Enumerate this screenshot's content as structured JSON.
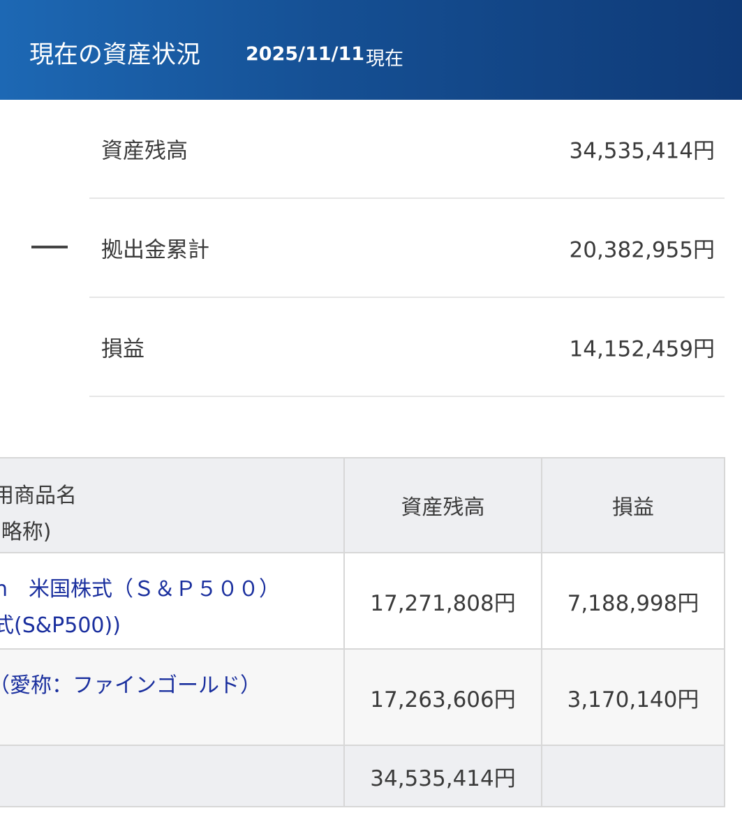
{
  "header": {
    "title": "現在の資産状況",
    "date": "2025/11/11",
    "as_of": "現在"
  },
  "summary": {
    "balance": {
      "label": "資産残高",
      "value": "34,535,414円"
    },
    "contribution": {
      "label": "拠出金累計",
      "value": "20,382,955円"
    },
    "profit": {
      "label": "損益",
      "value": "14,152,459円"
    }
  },
  "table": {
    "headers": {
      "name_line1": "用商品名",
      "name_line2": "(略称)",
      "balance": "資産残高",
      "profit": "損益"
    },
    "rows": [
      {
        "name_line1": "n　米国株式（Ｓ＆Ｐ５００）",
        "name_line2": "式(S&P500))",
        "balance": "17,271,808円",
        "profit": "7,188,998円"
      },
      {
        "name_line1": "（愛称：ファインゴールド）",
        "balance": "17,263,606円",
        "profit": "3,170,140円"
      }
    ],
    "total": {
      "balance": "34,535,414円"
    }
  }
}
